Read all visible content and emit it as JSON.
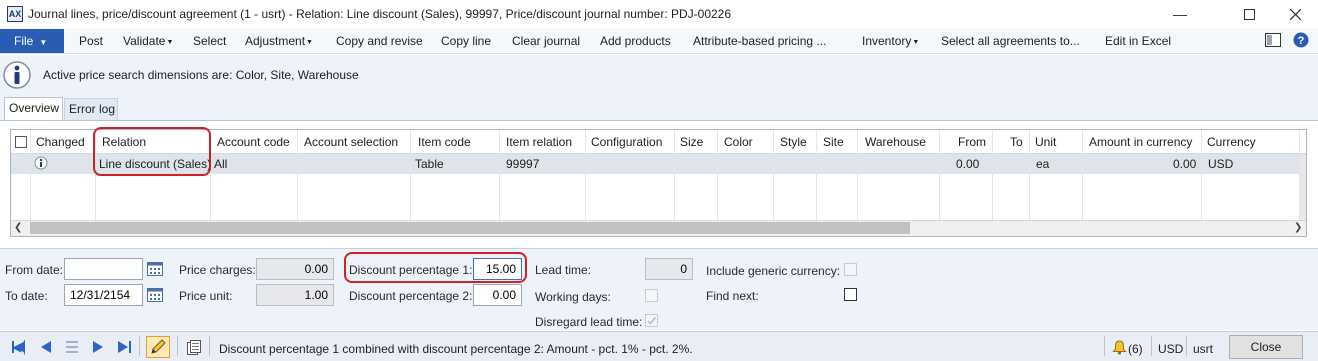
{
  "window": {
    "title": "Journal lines, price/discount agreement (1 - usrt) - Relation: Line discount (Sales), 99997, Price/discount journal number: PDJ-00226",
    "app_icon": "dynamics-ax-form-icon",
    "controls": {
      "minimize": "—",
      "maximize": "☐",
      "close": "✕"
    }
  },
  "menubar": {
    "file_label": "File",
    "items": [
      {
        "label": "Post",
        "dropdown": false
      },
      {
        "label": "Validate",
        "dropdown": true
      },
      {
        "label": "Select",
        "dropdown": false
      },
      {
        "label": "Adjustment",
        "dropdown": true
      },
      {
        "label": "Copy and revise",
        "dropdown": false
      },
      {
        "label": "Copy line",
        "dropdown": false
      },
      {
        "label": "Clear journal",
        "dropdown": false
      },
      {
        "label": "Add products",
        "dropdown": false
      },
      {
        "label": "Attribute-based pricing ...",
        "dropdown": false
      },
      {
        "label": "Inventory",
        "dropdown": true
      },
      {
        "label": "Select all agreements to...",
        "dropdown": false
      },
      {
        "label": "Edit in Excel",
        "dropdown": false
      }
    ],
    "right_icons": [
      "layout-icon",
      "help-icon"
    ]
  },
  "infolog": {
    "message": "Active price search dimensions are: Color, Site, Warehouse",
    "icon": "info-icon"
  },
  "tabs": [
    {
      "label": "Overview",
      "active": true
    },
    {
      "label": "Error log",
      "active": false
    }
  ],
  "grid": {
    "columns": [
      "Changed",
      "Relation",
      "Account code",
      "Account selection",
      "Item code",
      "Item relation",
      "Configuration",
      "Size",
      "Color",
      "Style",
      "Site",
      "Warehouse",
      "From",
      "To",
      "Unit",
      "Amount in currency",
      "Currency"
    ],
    "rows": [
      {
        "changed_icon": "info-icon",
        "relation": "Line discount (Sales)",
        "account_code": "All",
        "account_selection": "",
        "item_code": "Table",
        "item_relation": "99997",
        "configuration": "",
        "size": "",
        "color": "",
        "style": "",
        "site": "",
        "warehouse": "",
        "from": "0.00",
        "to": "",
        "unit": "ea",
        "amount_in_currency": "0.00",
        "currency": "USD"
      }
    ],
    "highlight_color": "#d0202a"
  },
  "form": {
    "from_date": {
      "label": "From date:",
      "value": ""
    },
    "to_date": {
      "label": "To date:",
      "value": "12/31/2154"
    },
    "price_charges": {
      "label": "Price charges:",
      "value": "0.00"
    },
    "price_unit": {
      "label": "Price unit:",
      "value": "1.00"
    },
    "discount_pct_1": {
      "label": "Discount percentage 1:",
      "value": "15.00"
    },
    "discount_pct_2": {
      "label": "Discount percentage 2:",
      "value": "0.00"
    },
    "lead_time": {
      "label": "Lead time:",
      "value": "0"
    },
    "working_days": {
      "label": "Working days:",
      "checked": false
    },
    "disregard_lead_time": {
      "label": "Disregard lead time:",
      "checked": true
    },
    "include_generic_currency": {
      "label": "Include generic currency:",
      "checked": false
    },
    "find_next": {
      "label": "Find next:",
      "checked": false
    }
  },
  "statusbar": {
    "message": "Discount percentage 1 combined with discount percentage 2: Amount - pct. 1% - pct. 2%.",
    "notifications": "(6)",
    "currency": "USD",
    "company": "usrt",
    "close_label": "Close"
  }
}
